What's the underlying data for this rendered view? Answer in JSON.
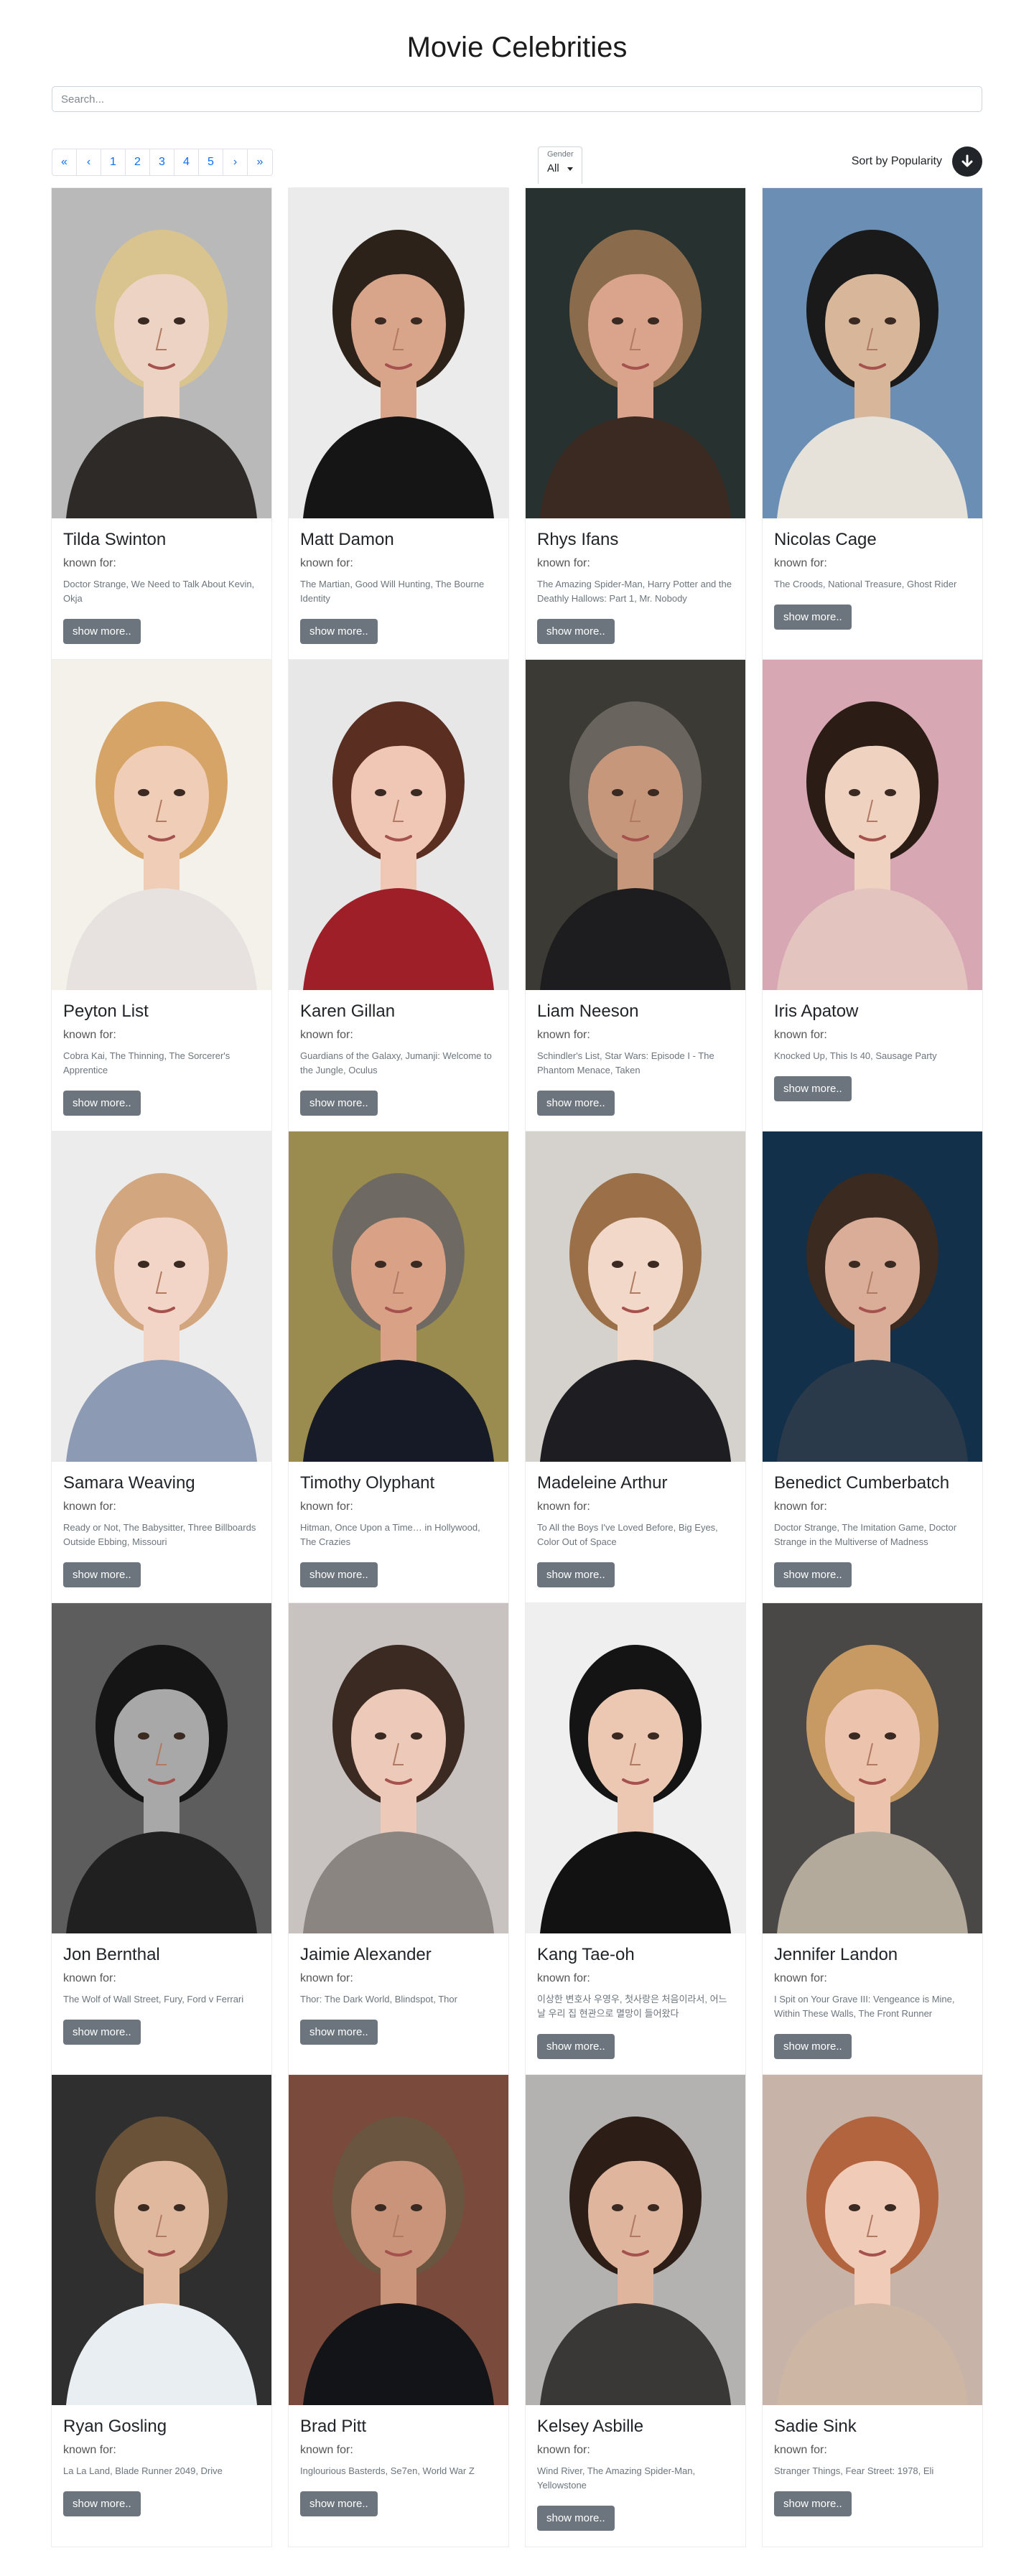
{
  "page": {
    "title": "Movie Celebrities"
  },
  "search": {
    "placeholder": "Search...",
    "value": ""
  },
  "pagination": {
    "items": [
      "«",
      "‹",
      "1",
      "2",
      "3",
      "4",
      "5",
      "›",
      "»"
    ]
  },
  "filter": {
    "label": "Gender",
    "value": "All"
  },
  "sort": {
    "label": "Sort by Popularity",
    "icon": "arrow-down-icon"
  },
  "card_labels": {
    "known_for": "known for:",
    "show_more": "show more.."
  },
  "celebrities": [
    {
      "name": "Tilda Swinton",
      "known_for": "Doctor Strange, We Need to Talk About Kevin, Okja",
      "bg": "#b9b9b9",
      "hair": "#d9c48f",
      "skin": "#ecd3c4",
      "clothes": "#2e2a28"
    },
    {
      "name": "Matt Damon",
      "known_for": "The Martian, Good Will Hunting, The Bourne Identity",
      "bg": "#ebebeb",
      "hair": "#2c2219",
      "skin": "#d8a48a",
      "clothes": "#151515"
    },
    {
      "name": "Rhys Ifans",
      "known_for": "The Amazing Spider-Man, Harry Potter and the Deathly Hallows: Part 1, Mr. Nobody",
      "bg": "#27312f",
      "hair": "#8a6b4b",
      "skin": "#d9a38c",
      "clothes": "#3a2a22"
    },
    {
      "name": "Nicolas Cage",
      "known_for": "The Croods, National Treasure, Ghost Rider",
      "bg": "#6b8fb4",
      "hair": "#1a1a1a",
      "skin": "#d7b69a",
      "clothes": "#e6e1d9"
    },
    {
      "name": "Peyton List",
      "known_for": "Cobra Kai, The Thinning, The Sorcerer's Apprentice",
      "bg": "#f4f0ea",
      "hair": "#d5a466",
      "skin": "#f0cdb6",
      "clothes": "#e7e2df"
    },
    {
      "name": "Karen Gillan",
      "known_for": "Guardians of the Galaxy, Jumanji: Welcome to the Jungle, Oculus",
      "bg": "#e7e7e7",
      "hair": "#5a2f22",
      "skin": "#f0c7b5",
      "clothes": "#9e1f27"
    },
    {
      "name": "Liam Neeson",
      "known_for": "Schindler's List, Star Wars: Episode I - The Phantom Menace, Taken",
      "bg": "#3b3a34",
      "hair": "#6a645e",
      "skin": "#c7977c",
      "clothes": "#1d1d1f"
    },
    {
      "name": "Iris Apatow",
      "known_for": "Knocked Up, This Is 40, Sausage Party",
      "bg": "#d7a7b4",
      "hair": "#2b1d16",
      "skin": "#f0d2c1",
      "clothes": "#e4c4bf"
    },
    {
      "name": "Samara Weaving",
      "known_for": "Ready or Not, The Babysitter, Three Billboards Outside Ebbing, Missouri",
      "bg": "#ececec",
      "hair": "#d2a780",
      "skin": "#f3d5c7",
      "clothes": "#8d9ab4"
    },
    {
      "name": "Timothy Olyphant",
      "known_for": "Hitman, Once Upon a Time… in Hollywood, The Crazies",
      "bg": "#9a8b4f",
      "hair": "#6e6a63",
      "skin": "#d9a286",
      "clothes": "#151a26"
    },
    {
      "name": "Madeleine Arthur",
      "known_for": "To All the Boys I've Loved Before, Big Eyes, Color Out of Space",
      "bg": "#d5d2cd",
      "hair": "#9b7049",
      "skin": "#f2d8c8",
      "clothes": "#1d1d22"
    },
    {
      "name": "Benedict Cumberbatch",
      "known_for": "Doctor Strange, The Imitation Game, Doctor Strange in the Multiverse of Madness",
      "bg": "#123049",
      "hair": "#3a2a20",
      "skin": "#d9ad97",
      "clothes": "#2b3a4a"
    },
    {
      "name": "Jon Bernthal",
      "known_for": "The Wolf of Wall Street, Fury, Ford v Ferrari",
      "bg": "#5d5d5d",
      "hair": "#151515",
      "skin": "#a8a8a8",
      "clothes": "#202020"
    },
    {
      "name": "Jaimie Alexander",
      "known_for": "Thor: The Dark World, Blindspot, Thor",
      "bg": "#c8c3c1",
      "hair": "#3b2a22",
      "skin": "#ecc9b8",
      "clothes": "#8a8580"
    },
    {
      "name": "Kang Tae-oh",
      "known_for": "이상한 변호사 우영우, 첫사랑은 처음이라서, 어느 날 우리 집 현관으로 멸망이 들어왔다",
      "bg": "#efefef",
      "hair": "#141414",
      "skin": "#ecc8b3",
      "clothes": "#121212"
    },
    {
      "name": "Jennifer Landon",
      "known_for": "I Spit on Your Grave III: Vengeance is Mine, Within These Walls, The Front Runner",
      "bg": "#4a4846",
      "hair": "#c79a64",
      "skin": "#ecc4ae",
      "clothes": "#b4aa9c"
    },
    {
      "name": "Ryan Gosling",
      "known_for": "La La Land, Blade Runner 2049, Drive",
      "bg": "#2f2f2f",
      "hair": "#6a5239",
      "skin": "#dfb89d",
      "clothes": "#e9eef2"
    },
    {
      "name": "Brad Pitt",
      "known_for": "Inglourious Basterds, Se7en, World War Z",
      "bg": "#7a4b3c",
      "hair": "#6a5540",
      "skin": "#c99479",
      "clothes": "#121418"
    },
    {
      "name": "Kelsey Asbille",
      "known_for": "Wind River, The Amazing Spider-Man, Yellowstone",
      "bg": "#b4b2b0",
      "hair": "#2c1e17",
      "skin": "#e0b59e",
      "clothes": "#3a3837"
    },
    {
      "name": "Sadie Sink",
      "known_for": "Stranger Things, Fear Street: 1978, Eli",
      "bg": "#c8b3a8",
      "hair": "#b2643f",
      "skin": "#f0cbb7",
      "clothes": "#cdb6a3"
    }
  ]
}
